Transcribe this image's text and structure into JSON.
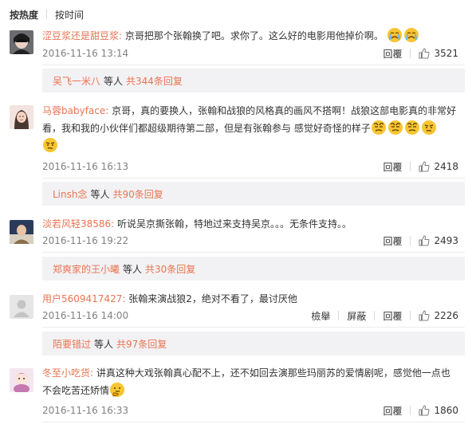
{
  "sort": {
    "hot_label": "按热度",
    "time_label": "按时间"
  },
  "comments": [
    {
      "user": "涩豆浆还是甜豆浆:",
      "line1": "京哥把那个张翰换了吧。求你了。这么好的电影用他掉价啊。",
      "line2": "",
      "date": "2016-11-16 13:14",
      "reply": "回覆",
      "likes": "3521",
      "emojis": [
        "crying-face-icon",
        "crying-face-icon"
      ],
      "reply_box": {
        "user": "吴飞一米八",
        "mid": "等人",
        "total": "共344条回复"
      }
    },
    {
      "user": "马蓉babyface:",
      "line1": "京哥，真的要换人，张翰和战狼的风格真的画风不搭啊！战狼这部电影真的非常好",
      "line2": "看，我和我的小伙伴们都超级期待第二部，但是有张翰参与 感觉好奇怪的样子",
      "date": "2016-11-16 16:13",
      "reply": "回覆",
      "likes": "2418",
      "emojis": [
        "sweat-face-icon",
        "sweat-face-icon",
        "sweat-face-icon",
        "skeptical-face-icon",
        "skeptical-face-icon"
      ],
      "reply_box": {
        "user": "Linsh念",
        "mid": "等人",
        "total": "共90条回复"
      }
    },
    {
      "user": "淡若风轻38586:",
      "line1": "听说吴京撕张翰，特地过来支持吴京。。。无条件支持。。",
      "line2": "",
      "date": "2016-11-16 19:22",
      "reply": "回覆",
      "likes": "2493",
      "emojis": [],
      "reply_box": {
        "user": "郑爽家的王小曦",
        "mid": "等人",
        "total": "共30条回复"
      }
    },
    {
      "user": "用户5609417427:",
      "line1": "张翰来演战狼2，绝对不看了，最讨厌他",
      "line2": "",
      "date": "2016-11-16 14:00",
      "report": "檢舉",
      "block": "屏蔽",
      "reply": "回覆",
      "likes": "2226",
      "emojis": [],
      "reply_box": {
        "user": "陌要错过",
        "mid": "等人",
        "total": "共97条回复"
      }
    },
    {
      "user": "冬至小吃货:",
      "line1": "讲真这种大戏张翰真心配不上，还不如回去演那些玛丽苏的爱情剧呢，感觉他一点也",
      "line2": "不会吃苦还矫情",
      "date": "2016-11-16 16:33",
      "reply": "回覆",
      "likes": "1860",
      "emojis": [
        "thinking-face-icon"
      ]
    }
  ],
  "colors": {
    "username": "#eb7350",
    "date": "#808080",
    "reply_bg": "#f2f2f5",
    "emoji_yellow": "#f7c531"
  }
}
